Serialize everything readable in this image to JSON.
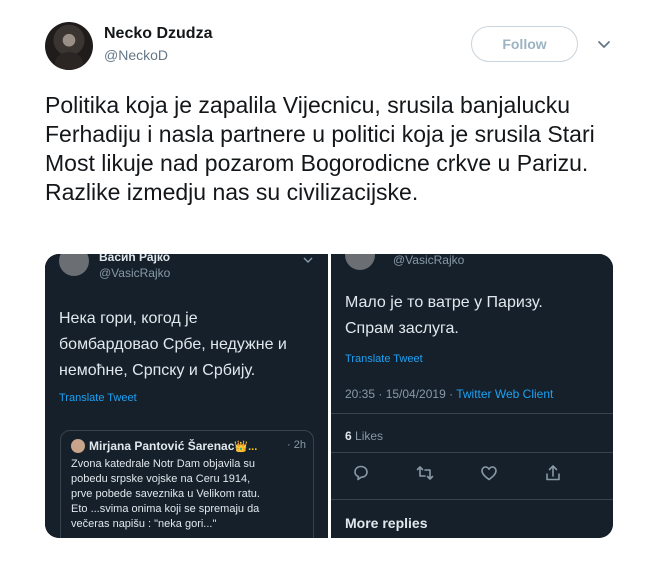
{
  "author": {
    "name": "Necko Dzudza",
    "handle": "@NeckoD"
  },
  "follow_label": "Follow",
  "icons": {
    "chevron": "chevron-down-icon",
    "reply": "reply-icon",
    "retweet": "retweet-icon",
    "like": "heart-icon",
    "share": "share-icon"
  },
  "tweet_text": "Politika koja je zapalila Vijecnicu,  srusila banjalucku Ferhadiju i nasla partnere u politici koja je srusila Stari Most likuje nad pozarom Bogorodicne crkve u Parizu.\nRazlike izmedju nas su civilizacijske.",
  "embedded_left": {
    "name": "Васић Рајко",
    "handle": "@VasicRajko",
    "text": "Нека гори, когод је\nбомбардовао Србе, недужне и\nнемоћне, Српску и Србију.",
    "translate": "Translate Tweet",
    "quote": {
      "name": "Mirjana Pantović Šarenac",
      "crown": "👑...",
      "time": "· 2h",
      "text": "Zvona katedrale Notr Dam objavila su\npobedu srpske vojske na Ceru 1914,\nprve pobede saveznika u Velikom ratu.\nEto ...svima onima koji se spremaju da\nvečeras napišu : \"neka gori...\""
    }
  },
  "embedded_right": {
    "handle": "@VasicRajko",
    "text": "Мало је то ватре у Паризу.\nСпрам заслуга.",
    "translate": "Translate Tweet",
    "timestamp": "20:35 · 15/04/2019 · ",
    "client": "Twitter Web Client",
    "likes_count": "6",
    "likes_label": " Likes",
    "more_replies": "More replies"
  },
  "colors": {
    "dark_bg": "#15202b",
    "accent": "#1da1f2"
  }
}
